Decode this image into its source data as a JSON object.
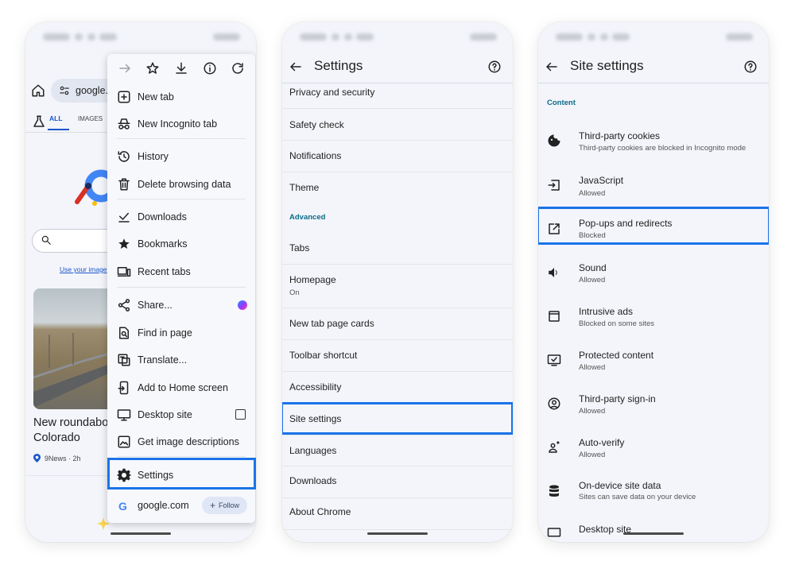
{
  "phone1": {
    "url_text": "google.co",
    "search_tabs": {
      "all": "ALL",
      "images": "IMAGES"
    },
    "image_link": "Use your image",
    "news_title_line1": "New roundabo",
    "news_title_line2": "Colorado",
    "news_source": "9News · 2h",
    "menu": {
      "toolbar_icons": [
        "forward-icon",
        "star-icon",
        "download-icon",
        "info-icon",
        "refresh-icon"
      ],
      "items": [
        {
          "label": "New tab",
          "icon": "plus-box-icon"
        },
        {
          "label": "New Incognito tab",
          "icon": "incognito-icon"
        },
        {
          "label": "History",
          "icon": "history-icon"
        },
        {
          "label": "Delete browsing data",
          "icon": "trash-icon"
        },
        {
          "label": "Downloads",
          "icon": "downloads-icon"
        },
        {
          "label": "Bookmarks",
          "icon": "bookmark-star-icon"
        },
        {
          "label": "Recent tabs",
          "icon": "devices-icon"
        },
        {
          "label": "Share...",
          "icon": "share-icon"
        },
        {
          "label": "Find in page",
          "icon": "find-in-page-icon"
        },
        {
          "label": "Translate...",
          "icon": "translate-icon"
        },
        {
          "label": "Add to Home screen",
          "icon": "add-to-home-icon"
        },
        {
          "label": "Desktop site",
          "icon": "monitor-icon"
        },
        {
          "label": "Get image descriptions",
          "icon": "image-icon"
        },
        {
          "label": "Settings",
          "icon": "gear-icon"
        }
      ],
      "site_label": "google.com",
      "follow_label": "Follow",
      "follow_plus": "+",
      "google_g": "G"
    }
  },
  "phone2": {
    "title": "Settings",
    "items": [
      {
        "label": "Privacy and security"
      },
      {
        "label": "Safety check"
      },
      {
        "label": "Notifications"
      },
      {
        "label": "Theme"
      },
      {
        "label": "Advanced"
      },
      {
        "label": "Tabs"
      },
      {
        "label": "Homepage",
        "sub": "On"
      },
      {
        "label": "New tab page cards"
      },
      {
        "label": "Toolbar shortcut"
      },
      {
        "label": "Accessibility"
      },
      {
        "label": "Site settings"
      },
      {
        "label": "Languages"
      },
      {
        "label": "Downloads"
      },
      {
        "label": "About Chrome"
      }
    ]
  },
  "phone3": {
    "title": "Site settings",
    "section": "Content",
    "items": [
      {
        "label": "Third-party cookies",
        "sub": "Third-party cookies are blocked in Incognito mode",
        "icon": "cookie-icon"
      },
      {
        "label": "JavaScript",
        "sub": "Allowed",
        "icon": "javascript-icon"
      },
      {
        "label": "Pop-ups and redirects",
        "sub": "Blocked",
        "icon": "open-external-icon"
      },
      {
        "label": "Sound",
        "sub": "Allowed",
        "icon": "speaker-icon"
      },
      {
        "label": "Intrusive ads",
        "sub": "Blocked on some sites",
        "icon": "ad-box-icon"
      },
      {
        "label": "Protected content",
        "sub": "Allowed",
        "icon": "protected-content-icon"
      },
      {
        "label": "Third-party sign-in",
        "sub": "Allowed",
        "icon": "account-circle-icon"
      },
      {
        "label": "Auto-verify",
        "sub": "Allowed",
        "icon": "person-verify-icon"
      },
      {
        "label": "On-device site data",
        "sub": "Sites can save data on your device",
        "icon": "database-icon"
      },
      {
        "label": "Desktop site",
        "icon": "monitor-icon"
      }
    ]
  },
  "colors": {
    "accent": "#1a73e8",
    "section": "#0b6b86",
    "panel_bg": "#f3f5fb"
  }
}
